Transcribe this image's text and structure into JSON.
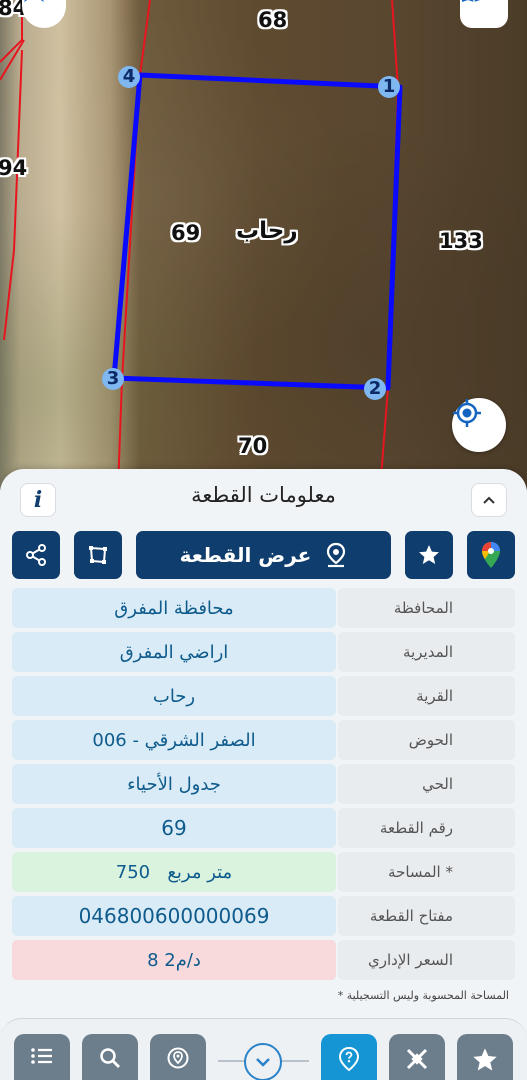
{
  "map": {
    "parcel_numbers": {
      "top": "68",
      "top_left_edge": "84",
      "left": "94",
      "center": "69",
      "right": "133",
      "bottom": "70"
    },
    "village_label": "رحاب",
    "vertices": [
      "1",
      "2",
      "3",
      "4"
    ],
    "colors": {
      "parcel_outline": "#0a0aff",
      "boundary_lines": "#e8141e",
      "vertex_fill": "#7fb7f0"
    }
  },
  "panel": {
    "title": "معلومات القطعة",
    "info_button_label": "i",
    "show_parcel_label": "عرض القطعة",
    "rows": [
      {
        "label": "المحافظة",
        "value": "محافظة المفرق"
      },
      {
        "label": "المديرية",
        "value": "اراضي المفرق"
      },
      {
        "label": "القرية",
        "value": "رحاب"
      },
      {
        "label": "الحوض",
        "value": "الصفر الشرقي - 006"
      },
      {
        "label": "الحي",
        "value": "جدول الأحياء"
      },
      {
        "label": "رقم القطعة",
        "value": "69"
      },
      {
        "label": "المساحة *",
        "value": "750   متر مربع"
      },
      {
        "label": "مفتاح القطعة",
        "value": "046800600000069"
      },
      {
        "label": "السعر الإداري",
        "value": "8 د/م2"
      }
    ],
    "footnote": "* المساحة المحسوبة وليس التسجيلية"
  },
  "icons": [
    "north-arrow-icon",
    "map-layers-icon",
    "locate-icon",
    "info-icon",
    "chevron-up-icon",
    "share-icon",
    "polygon-icon",
    "location-pin-icon",
    "star-icon",
    "google-maps-icon",
    "list-icon",
    "search-icon",
    "location-search-icon",
    "chevron-down-icon",
    "help-pin-icon",
    "satellite-icon"
  ]
}
